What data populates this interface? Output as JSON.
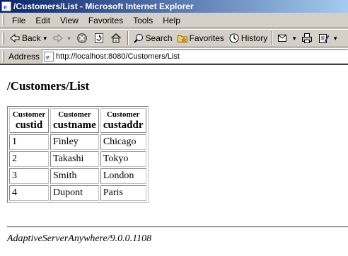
{
  "window": {
    "title": "/Customers/List - Microsoft Internet Explorer"
  },
  "menu": {
    "items": [
      "File",
      "Edit",
      "View",
      "Favorites",
      "Tools",
      "Help"
    ]
  },
  "toolbar": {
    "back_label": "Back",
    "search_label": "Search",
    "favorites_label": "Favorites",
    "history_label": "History"
  },
  "address": {
    "label": "Address",
    "url": "http://localhost:8080/Customers/List"
  },
  "page": {
    "heading": "/Customers/List",
    "table": {
      "columns": [
        {
          "table": "Customer",
          "name": "custid"
        },
        {
          "table": "Customer",
          "name": "custname"
        },
        {
          "table": "Customer",
          "name": "custaddr"
        }
      ],
      "rows": [
        [
          "1",
          "Finley",
          "Chicago"
        ],
        [
          "2",
          "Takashi",
          "Tokyo"
        ],
        [
          "3",
          "Smith",
          "London"
        ],
        [
          "4",
          "Dupont",
          "Paris"
        ]
      ]
    },
    "footer": "AdaptiveServerAnywhere/9.0.0.1108"
  },
  "colors": {
    "titlebar_start": "#0a246a",
    "titlebar_end": "#a6caf0",
    "chrome": "#d4d0c8"
  }
}
